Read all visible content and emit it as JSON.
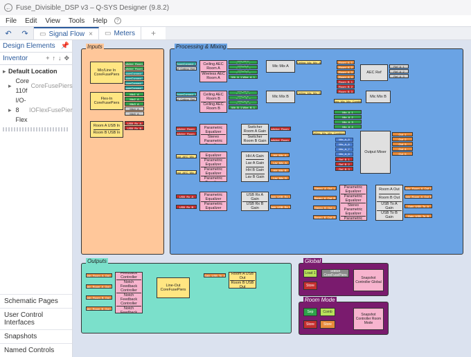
{
  "titlebar": {
    "text": "Fuse_Divisible_DSP v3 – Q-SYS Designer (9.8.2)"
  },
  "menu": {
    "file": "File",
    "edit": "Edit",
    "view": "View",
    "tools": "Tools",
    "help": "Help"
  },
  "toolbar": {
    "tab1": "Signal Flow",
    "tab2": "Meters"
  },
  "sidebar": {
    "header": "Design Elements",
    "inventor": "Inventor",
    "default_location": "Default Location",
    "core": "Core 110f",
    "core_suffix": "CoreFusePiers",
    "io": "I/O-8 Flex",
    "io_suffix": "IOFlexFusePiers",
    "links": [
      "Schematic Pages",
      "User Control Interfaces",
      "Snapshots",
      "Named Controls"
    ]
  },
  "groups": {
    "inputs": "Inputs",
    "procmix": "Processing & Mixing",
    "outputs": "Outputs",
    "global": "Global",
    "roommode": "Room Mode"
  },
  "blk": {
    "micline": "Mic/Line In\nCoreFusePiers",
    "flexin": "Flex-In\nCoreFusePiers",
    "usb_rooma": "Room A\nUSB In",
    "usb_roomb": "Room B\nUSB In",
    "switA": "Switcher_Room_A",
    "switB": "Switcher_Room_B",
    "micsA": [
      "RoomConnect_A",
      "RoomConnect_B",
      "RoomConnect_C",
      "RoomConnect_D"
    ],
    "micsB": [
      "Mic1_A",
      "Mic2_A",
      "Mic3_A",
      "Mic4_A",
      "Mic5_A"
    ],
    "aecref": "AEC Ref",
    "micmixA": "Mic Mix A",
    "micmixB": "Mic Mix B",
    "ceilA": "Ceiling\nAEC Room\nA",
    "wirA": "Wireless\nAEC Room A",
    "ceilB": "Ceiling\nAEC Room\nB",
    "wirB": "Ceiling AEC\nRoom B",
    "speqA": "Stereo\nParametric\nEqualizer",
    "speqB": "Stereo\nParametric\nEqualizer",
    "swgA": "Switcher\nRoom A\nGain",
    "swgB": "Switcher\nRoom B\nGain",
    "peq": "Parametric\nEqualizer",
    "hhA": "HH A Gain",
    "lavA": "Lav A Gain",
    "hhB": "HH B Gain",
    "lavB": "Lav B Gain",
    "usbrxA": "USB Rx A\nGain",
    "usbrxB": "USB Rx B\nGain",
    "outmix": "Output\nMixer",
    "routA": "Room A\nOut",
    "routB": "Room B\nOut",
    "usbtoA": "USB To A\nGain",
    "usbtoB": "USB To B\nGain",
    "lineout": "Line-Out\nCoreFusePiers",
    "rausb": "Room A\nUSB Out",
    "rbusb": "Room B\nUSB Out",
    "nfc": "Notch\nFeedback\nController",
    "snapG": "Snapshot\nController\nGlobal",
    "snapR": "Snapshot\nController\nRoom\nMode",
    "status": "Status\nCoreFusePiers",
    "load": "Load\n1",
    "sep": "Sep",
    "comb": "Comb",
    "store": "Store",
    "store2": "Store",
    "tagsL": [
      "HDMI_A_L",
      "HDMI_A_R",
      "HDMI_B_L",
      "HDMI_B_R",
      "PGM_A",
      "PGM_B"
    ],
    "ceilTagsA": [
      "Ceil_AEC Ceiling_A_1",
      "Ceil_A_2 Ceiling_A_2",
      "Ceil_A_3 Ceiling_A_3",
      "Wir_A_1 Wire_A_1"
    ],
    "ceilTagsB": [
      "Ceil_AEC Ceiling_B_1",
      "Ceil_B_2 Ceiling_B_2",
      "Ceil_B_3 Ceiling_B_3",
      "Wir_B_1 Wire_B_1"
    ],
    "ceilMixA": "Ceiling_Mic_Mix_A",
    "ceilMixB": "Ceiling_Mic_Mix_B",
    "ceilMixComb": "Ceiling_Mic_Mix_Combined",
    "aecCol": [
      "Room_A_1",
      "Room_A_2",
      "Room_A_3",
      "Room_A_4",
      "Room_B_1",
      "Room_B_2",
      "Room_B_3"
    ],
    "swRedA": "Switcher_Room_A",
    "swRedB": "Switcher_Room_B",
    "mixRefs": [
      "Ref_A_1",
      "Ref_A_2",
      "Ref_A_3",
      "Ref_B_1",
      "Ref_B_2",
      "Ref_B_3",
      "Ref_B_4"
    ],
    "blueMixA": [
      "Mix_A_1",
      "Mix_A_2",
      "Mix_A_3",
      "Mix_A_4",
      "Mix_A_5",
      "Mix_A_6",
      "Mix_A_7",
      "Mix_A_8"
    ],
    "blueMixB": [
      "Out_1",
      "Out_2",
      "Out_3",
      "Out_4",
      "Out_5"
    ],
    "outRow": [
      "Stereo_A_Out_L",
      "Stereo_A_Out_R",
      "Stereo_B_Out_L",
      "Stereo_B_Out_R"
    ],
    "outSpk": [
      "Spkr_Room_A_Out_L",
      "Spkr_Room_A_Out_R",
      "Spkr_Room_B_Out_L",
      "Spkr_Room_B_Out_R"
    ],
    "usbTags": [
      "USB_Rx_A",
      "USB_Rx_B"
    ],
    "gainT": [
      "Gain_USB_Rx_A",
      "Gain_USB_Rx_B"
    ],
    "outUsb": [
      "Gain_USB_To_A",
      "Gain_USB_To_B"
    ],
    "gtags": [
      "Post_AEC_Mic_A",
      "Post_AEC_Mic_B"
    ],
    "hhTags": [
      "HH_Mic_A",
      "Lav_Mic_A",
      "HH_Mic_B",
      "Lav_Mic_B"
    ],
    "rcA": [
      "RoomConnect_A",
      "Ref_Ceiling_Ref_A"
    ],
    "rcB": [
      "RoomConnect_B",
      "Ref_Ceiling_Ref_B"
    ],
    "otagsL": [
      "Gain_Room_A_Out_L",
      "Gain_Room_A_Out_R",
      "Gain_Room_B_Out_L",
      "Gain_Room_B_Out_R"
    ],
    "otagsR": [
      "Spkr_Room_A_Out_L",
      "Spkr_Room_A_Out_R"
    ]
  }
}
